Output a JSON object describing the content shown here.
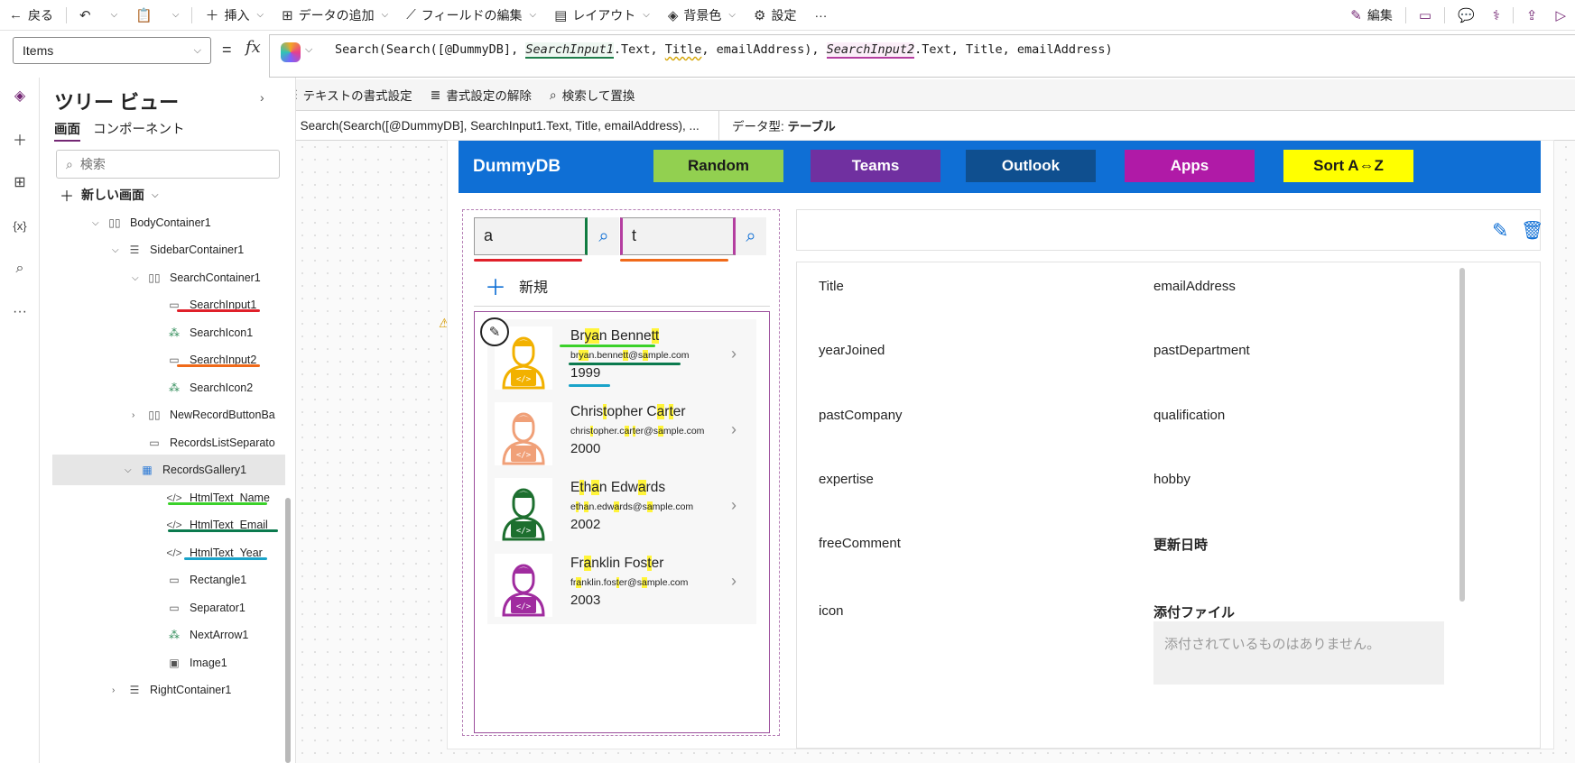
{
  "commandbar": {
    "back": "戻る",
    "insert": "挿入",
    "add_data": "データの追加",
    "edit_fields": "フィールドの編集",
    "layout": "レイアウト",
    "background": "背景色",
    "settings": "設定",
    "more": "···",
    "edit": "編集"
  },
  "formula_bar": {
    "property": "Items",
    "equals": "=",
    "fx": "fx",
    "tokens": {
      "p1": "Search(Search([@DummyDB], ",
      "ctl1": "SearchInput1",
      "p2": ".Text, ",
      "f1": "Title",
      "p3": ", emailAddress), ",
      "ctl2": "SearchInput2",
      "p4": ".Text, Title, emailAddress)"
    },
    "format_text": "テキストの書式設定",
    "clear_format": "書式設定の解除",
    "find_replace": "検索して置換",
    "result_expression": "Search(Search([@DummyDB], SearchInput1.Text, Title, emailAddress), ...",
    "data_type_label": "データ型: ",
    "data_type_value": "テーブル"
  },
  "tree": {
    "title": "ツリー ビュー",
    "tabs": [
      "画面",
      "コンポーネント"
    ],
    "search_placeholder": "検索",
    "new_screen": "新しい画面",
    "nodes": [
      {
        "label": "BodyContainer1"
      },
      {
        "label": "SidebarContainer1"
      },
      {
        "label": "SearchContainer1"
      },
      {
        "label": "SearchInput1"
      },
      {
        "label": "SearchIcon1"
      },
      {
        "label": "SearchInput2"
      },
      {
        "label": "SearchIcon2"
      },
      {
        "label": "NewRecordButtonBa"
      },
      {
        "label": "RecordsListSeparato"
      },
      {
        "label": "RecordsGallery1"
      },
      {
        "label": "HtmlText_Name"
      },
      {
        "label": "HtmlText_Email"
      },
      {
        "label": "HtmlText_Year"
      },
      {
        "label": "Rectangle1"
      },
      {
        "label": "Separator1"
      },
      {
        "label": "NextArrow1"
      },
      {
        "label": "Image1"
      },
      {
        "label": "RightContainer1"
      }
    ]
  },
  "app": {
    "title": "DummyDB",
    "buttons": [
      {
        "label": "Random",
        "bg": "#92d050",
        "fg": "#1a1a1a"
      },
      {
        "label": "Teams",
        "bg": "#7030a0",
        "fg": "#ffffff"
      },
      {
        "label": "Outlook",
        "bg": "#0f4f8f",
        "fg": "#ffffff"
      },
      {
        "label": "Apps",
        "bg": "#b01aa7",
        "fg": "#ffffff"
      },
      {
        "label": "Sort A⇔Z",
        "bg": "#ffff00",
        "fg": "#1a1a1a"
      }
    ],
    "search1_value": "a",
    "search2_value": "t",
    "new_record": "新規",
    "records": [
      {
        "name_parts": [
          "Br",
          "y",
          "",
          "a",
          "n Benne",
          "tt"
        ],
        "email_parts": [
          "br",
          "y",
          "",
          "a",
          "n.benne",
          "tt",
          "@s",
          "a",
          "mple.com"
        ],
        "year": "1999",
        "color": "#f2b100"
      },
      {
        "name_parts": [
          "Chris",
          "t",
          "opher C",
          "a",
          "r",
          "t",
          "er"
        ],
        "email_parts": [
          "chris",
          "t",
          "opher.c",
          "a",
          "r",
          "t",
          "er@s",
          "a",
          "mple.com"
        ],
        "year": "2000",
        "color": "#f0a078"
      },
      {
        "name_parts": [
          "E",
          "t",
          "h",
          "a",
          "n Edw",
          "a",
          "rds"
        ],
        "email_parts": [
          "e",
          "t",
          "h",
          "a",
          "n.edw",
          "a",
          "rds@s",
          "a",
          "mple.com"
        ],
        "year": "2002",
        "color": "#1d6f2f"
      },
      {
        "name_parts": [
          "Fr",
          "a",
          "nklin Fos",
          "t",
          "er"
        ],
        "email_parts": [
          "fr",
          "a",
          "nklin.fos",
          "t",
          "er@s",
          "a",
          "mple.com"
        ],
        "year": "2003",
        "color": "#a02c9f"
      }
    ],
    "detail_fields": {
      "title": "Title",
      "email": "emailAddress",
      "year_joined": "yearJoined",
      "past_department": "pastDepartment",
      "past_company": "pastCompany",
      "qualification": "qualification",
      "expertise": "expertise",
      "hobby": "hobby",
      "free_comment": "freeComment",
      "updated": "更新日時",
      "icon": "icon",
      "attachments": "添付ファイル",
      "no_attachments": "添付されているものはありません。"
    }
  },
  "colors": {
    "accent": "#742774",
    "header_blue": "#0f6fd5",
    "annotation_red": "#e0202a",
    "annotation_orange": "#f06a1a",
    "annotation_green": "#3bd12a",
    "annotation_darkgreen": "#0b7a4e",
    "annotation_cyan": "#1aa3c9"
  }
}
